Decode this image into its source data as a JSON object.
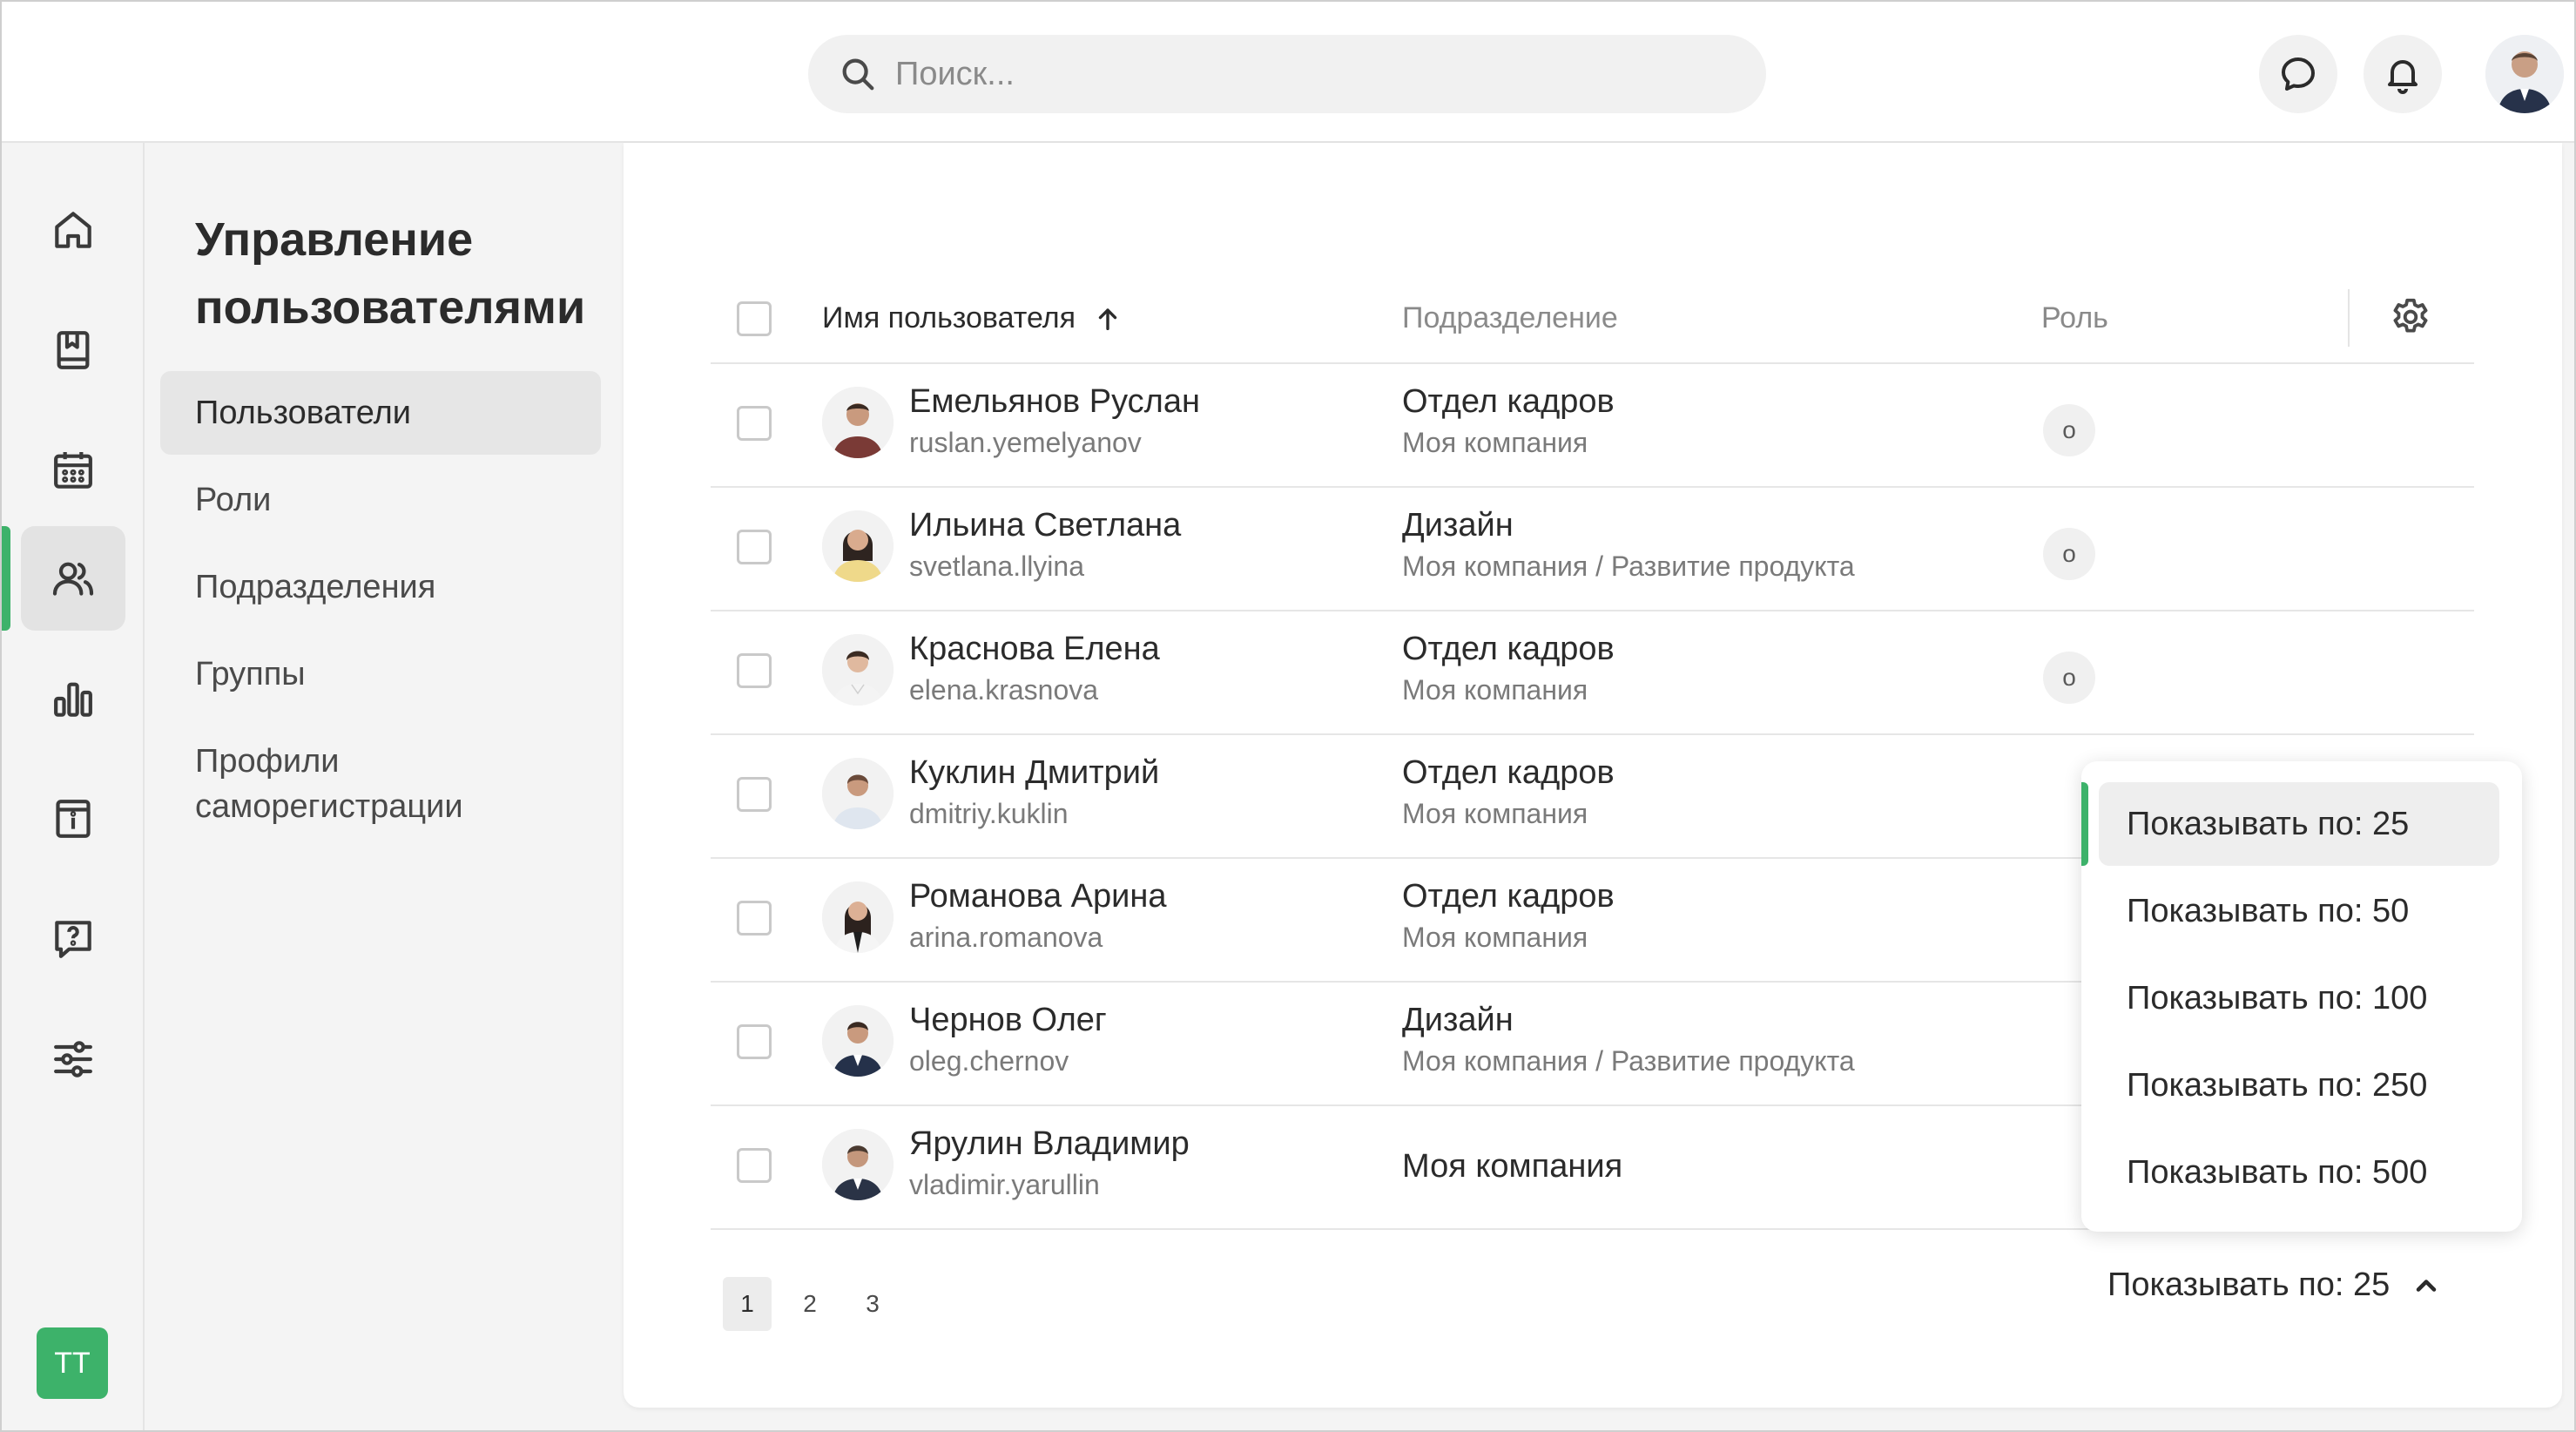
{
  "header": {
    "search_placeholder": "Поиск..."
  },
  "rail": {
    "items": [
      "home-icon",
      "book-icon",
      "calendar-icon",
      "users-icon",
      "chart-icon",
      "info-icon",
      "help-icon",
      "sliders-icon"
    ],
    "active": "users-icon",
    "user_initials": "ТТ"
  },
  "subnav": {
    "title": "Управление пользователями",
    "items": [
      {
        "label": "Пользователи",
        "active": true
      },
      {
        "label": "Роли"
      },
      {
        "label": "Подразделения"
      },
      {
        "label": "Группы"
      },
      {
        "label": "Профили саморегистрации"
      }
    ]
  },
  "table": {
    "columns": {
      "name": "Имя пользователя",
      "department": "Подразделение",
      "role": "Роль"
    },
    "sort_indicator": "↑",
    "rows": [
      {
        "name": "Емельянов Руслан",
        "login": "ruslan.yemelyanov",
        "dept": "Отдел кадров",
        "path": "Моя компания",
        "role": "о"
      },
      {
        "name": "Ильина Светлана",
        "login": "svetlana.llyina",
        "dept": "Дизайн",
        "path": "Моя компания / Развитие продукта",
        "role": "о"
      },
      {
        "name": "Краснова Елена",
        "login": "elena.krasnova",
        "dept": "Отдел кадров",
        "path": "Моя компания",
        "role": "о"
      },
      {
        "name": "Куклин Дмитрий",
        "login": "dmitriy.kuklin",
        "dept": "Отдел кадров",
        "path": "Моя компания",
        "role": ""
      },
      {
        "name": "Романова Арина",
        "login": "arina.romanova",
        "dept": "Отдел кадров",
        "path": "Моя компания",
        "role": ""
      },
      {
        "name": "Чернов Олег",
        "login": "oleg.chernov",
        "dept": "Дизайн",
        "path": "Моя компания / Развитие продукта",
        "role": ""
      },
      {
        "name": "Ярулин Владимир",
        "login": "vladimir.yarullin",
        "dept": "Моя компания",
        "path": "",
        "role": ""
      }
    ]
  },
  "pagination": {
    "pages": [
      "1",
      "2",
      "3"
    ],
    "current": "1",
    "page_size_label": "Показывать по: 25"
  },
  "dropdown": {
    "options": [
      "Показывать по: 25",
      "Показывать по: 50",
      "Показывать по: 100",
      "Показывать по: 250",
      "Показывать по: 500"
    ],
    "selected": "Показывать по: 25"
  },
  "colors": {
    "accent": "#3db26a",
    "active_bg": "#e3e3e3"
  }
}
